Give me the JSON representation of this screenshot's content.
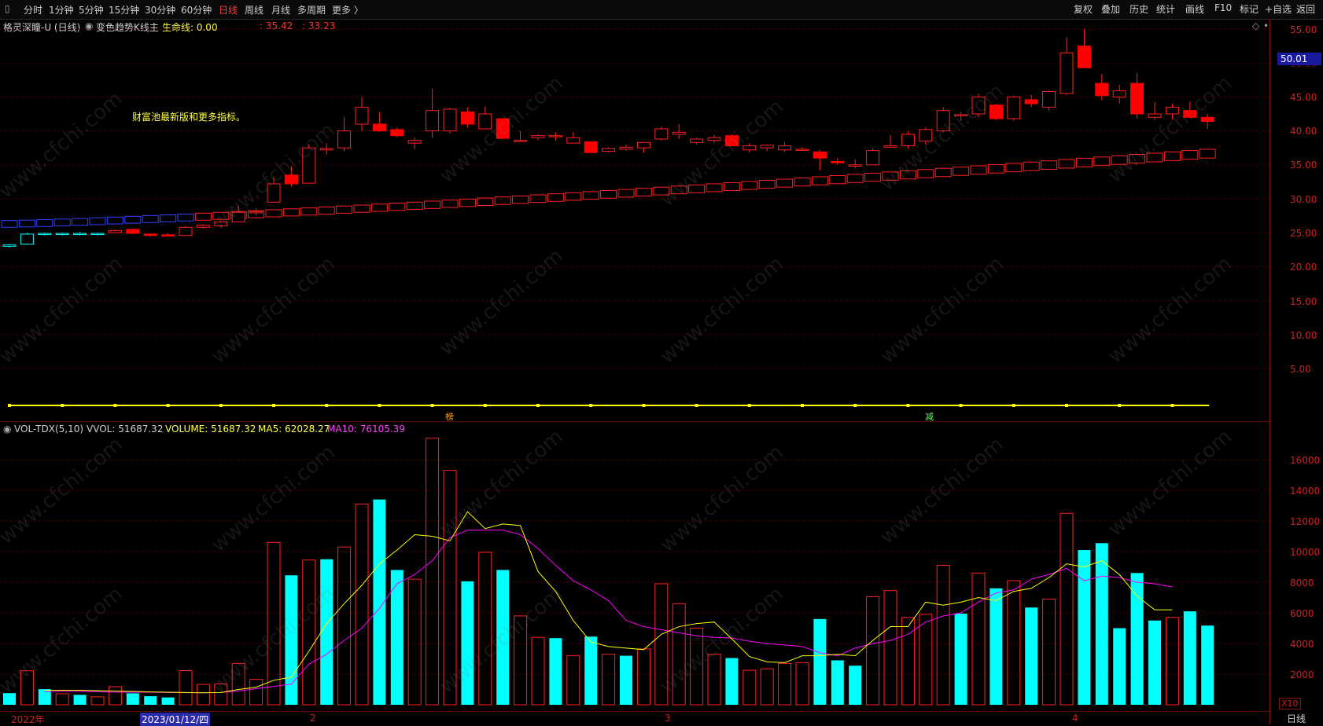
{
  "toolbar": {
    "left_items": [
      "分时",
      "1分钟",
      "5分钟",
      "15分钟",
      "30分钟",
      "60分钟",
      "日线",
      "周线",
      "月线",
      "多周期",
      "更多 〉"
    ],
    "active_item": "日线",
    "right_items": [
      "复权",
      "叠加",
      "历史",
      "统计",
      "画线",
      "F10",
      "标记",
      "+自选",
      "返回"
    ]
  },
  "price_header": {
    "stock": "格灵深瞳-U (日线)",
    "indicator": "变色趋势K线主",
    "lifeline_label": "生命线: 0.00",
    "v1": ": 35.42",
    "v2": ": 33.23"
  },
  "note_text": "财富池最新版和更多指标。",
  "markers": {
    "m1": "榜",
    "m2": "减"
  },
  "volume_header": {
    "name": "VOL-TDX(5,10)",
    "vvol": "VVOL: 51687.32",
    "volume": "VOLUME: 51687.32",
    "ma5": "MA5: 62028.27",
    "ma10": "MA10: 76105.39"
  },
  "price_axis": [
    "55.00",
    "50.00",
    "45.00",
    "40.00",
    "35.00",
    "30.00",
    "25.00",
    "20.00",
    "15.00",
    "10.00",
    "5.00"
  ],
  "price_badge": "50.01",
  "volume_axis": [
    "16000",
    "14000",
    "12000",
    "10000",
    "8000",
    "6000",
    "4000",
    "2000"
  ],
  "volume_unit": "X10",
  "dates": {
    "d1": "2022年",
    "d2": "2023/01/12/四",
    "d3": "2",
    "d4": "3",
    "d5": "4"
  },
  "period_label": "日线",
  "watermark": "www.cfchi.com",
  "colors": {
    "up": "#ff2020",
    "down_fill": "#ff0000",
    "cyan": "#00ffff",
    "lifeline": "#ffff00",
    "ma5": "#ffff00",
    "ma10": "#ff00ff",
    "trend_blue": "#3040ff"
  },
  "chart_data": {
    "type": "candlestick",
    "candles": [
      [
        23.0,
        23.3,
        22.8,
        23.2,
        "c"
      ],
      [
        23.3,
        25.0,
        23.2,
        24.8,
        "c"
      ],
      [
        24.9,
        25.0,
        24.6,
        24.8,
        "c"
      ],
      [
        24.8,
        25.0,
        24.6,
        24.9,
        "c"
      ],
      [
        24.9,
        25.1,
        24.6,
        24.8,
        "c"
      ],
      [
        24.8,
        25.0,
        24.6,
        24.9,
        "c"
      ],
      [
        25.0,
        25.5,
        24.9,
        25.3,
        "r"
      ],
      [
        25.5,
        25.6,
        24.8,
        24.9,
        "f"
      ],
      [
        24.8,
        24.9,
        24.4,
        24.6,
        "f"
      ],
      [
        24.7,
        24.9,
        24.5,
        24.5,
        "f"
      ],
      [
        24.6,
        26.0,
        24.6,
        25.8,
        "r"
      ],
      [
        25.8,
        26.3,
        25.6,
        26.1,
        "r"
      ],
      [
        26.0,
        26.8,
        25.8,
        26.6,
        "r"
      ],
      [
        26.6,
        29.0,
        26.5,
        28.0,
        "r"
      ],
      [
        28.0,
        28.6,
        27.6,
        28.1,
        "r"
      ],
      [
        29.5,
        33.2,
        29.5,
        32.2,
        "r"
      ],
      [
        32.2,
        34.8,
        31.8,
        33.5,
        "f"
      ],
      [
        32.3,
        38.0,
        32.3,
        37.5,
        "r"
      ],
      [
        37.4,
        38.2,
        36.5,
        37.2,
        "r"
      ],
      [
        37.5,
        42.0,
        37.0,
        40.0,
        "r"
      ],
      [
        41.0,
        45.0,
        40.0,
        43.5,
        "r"
      ],
      [
        41.0,
        42.8,
        39.8,
        40.0,
        "f"
      ],
      [
        40.2,
        40.5,
        39.1,
        39.3,
        "f"
      ],
      [
        38.6,
        39.0,
        37.3,
        38.2,
        "r"
      ],
      [
        40.0,
        46.2,
        39.0,
        43.0,
        "r"
      ],
      [
        40.0,
        43.4,
        39.6,
        43.2,
        "r"
      ],
      [
        42.8,
        43.5,
        40.5,
        41.0,
        "f"
      ],
      [
        40.3,
        43.6,
        40.3,
        42.5,
        "r"
      ],
      [
        41.8,
        41.8,
        38.8,
        38.9,
        "f"
      ],
      [
        38.6,
        40.0,
        38.4,
        38.6,
        "r"
      ],
      [
        39.0,
        39.5,
        38.6,
        39.3,
        "r"
      ],
      [
        39.2,
        39.8,
        38.6,
        39.3,
        "r"
      ],
      [
        39.0,
        39.8,
        38.2,
        38.2,
        "r"
      ],
      [
        38.4,
        38.4,
        36.8,
        36.8,
        "f"
      ],
      [
        37.0,
        37.6,
        36.8,
        37.4,
        "r"
      ],
      [
        37.3,
        38.0,
        37.1,
        37.6,
        "r"
      ],
      [
        37.5,
        38.4,
        36.8,
        38.3,
        "r"
      ],
      [
        38.8,
        40.6,
        38.6,
        40.3,
        "r"
      ],
      [
        39.5,
        41.0,
        38.8,
        39.8,
        "r"
      ],
      [
        38.3,
        39.0,
        38.0,
        38.8,
        "r"
      ],
      [
        38.6,
        39.4,
        38.2,
        39.0,
        "r"
      ],
      [
        39.3,
        39.5,
        37.8,
        37.8,
        "f"
      ],
      [
        37.2,
        38.2,
        36.8,
        37.8,
        "r"
      ],
      [
        37.5,
        38.0,
        37.0,
        37.9,
        "r"
      ],
      [
        37.2,
        38.3,
        36.9,
        37.8,
        "r"
      ],
      [
        37.3,
        37.6,
        37.1,
        37.2,
        "r"
      ],
      [
        36.9,
        37.2,
        34.2,
        36.0,
        "f"
      ],
      [
        35.5,
        36.0,
        35.0,
        35.3,
        "f"
      ],
      [
        34.8,
        35.8,
        34.5,
        35.0,
        "r"
      ],
      [
        35.0,
        37.4,
        35.0,
        37.1,
        "r"
      ],
      [
        37.6,
        39.4,
        37.5,
        37.8,
        "r"
      ],
      [
        37.8,
        40.0,
        37.4,
        39.5,
        "r"
      ],
      [
        38.5,
        40.5,
        38.0,
        40.2,
        "r"
      ],
      [
        40.0,
        43.5,
        39.8,
        43.0,
        "r"
      ],
      [
        42.3,
        42.8,
        41.5,
        42.4,
        "r"
      ],
      [
        42.5,
        45.5,
        42.0,
        45.0,
        "r"
      ],
      [
        43.8,
        44.0,
        41.6,
        41.8,
        "f"
      ],
      [
        41.8,
        45.2,
        41.5,
        45.0,
        "r"
      ],
      [
        44.6,
        45.3,
        43.5,
        44.0,
        "f"
      ],
      [
        43.5,
        46.0,
        43.0,
        45.8,
        "r"
      ],
      [
        45.5,
        53.8,
        45.3,
        51.5,
        "r"
      ],
      [
        52.5,
        55.0,
        49.2,
        49.3,
        "f"
      ],
      [
        47.0,
        48.4,
        44.5,
        45.2,
        "f"
      ],
      [
        45.0,
        46.8,
        44.0,
        45.9,
        "r"
      ],
      [
        47.0,
        48.5,
        41.8,
        42.5,
        "f"
      ],
      [
        42.5,
        44.2,
        41.6,
        42.0,
        "r"
      ],
      [
        42.5,
        44.0,
        41.6,
        43.5,
        "r"
      ],
      [
        43.0,
        44.3,
        41.9,
        42.0,
        "f"
      ],
      [
        42.0,
        42.5,
        40.3,
        41.4,
        "f"
      ]
    ],
    "lifeline": 1.5,
    "trend_lower": [
      25.8,
      36.0
    ],
    "trend_upper": [
      26.8,
      37.3
    ],
    "volume": [
      760,
      2220,
      1020,
      720,
      650,
      520,
      1180,
      750,
      560,
      480,
      2230,
      1330,
      1370,
      2700,
      1660,
      10600,
      8450,
      9450,
      9500,
      10300,
      13100,
      13400,
      8800,
      8200,
      17400,
      15300,
      8060,
      9950,
      8800,
      5800,
      4400,
      4350,
      3200,
      4450,
      3300,
      3200,
      3650,
      7900,
      6600,
      5000,
      3300,
      3050,
      2250,
      2350,
      2700,
      2750,
      5600,
      2900,
      2550,
      7050,
      7450,
      5700,
      5900,
      9100,
      5950,
      8600,
      7600,
      8100,
      6350,
      6900,
      12500,
      10100,
      10550,
      5000,
      8600,
      5500,
      5700,
      6100,
      5170
    ],
    "volume_fill": [
      "c",
      "r",
      "c",
      "r",
      "c",
      "r",
      "r",
      "c",
      "c",
      "c",
      "r",
      "r",
      "r",
      "r",
      "r",
      "r",
      "c",
      "r",
      "c",
      "r",
      "r",
      "c",
      "c",
      "r",
      "r",
      "r",
      "c",
      "r",
      "c",
      "r",
      "r",
      "c",
      "r",
      "c",
      "r",
      "c",
      "r",
      "r",
      "r",
      "r",
      "r",
      "c",
      "r",
      "r",
      "r",
      "r",
      "c",
      "c",
      "c",
      "r",
      "r",
      "r",
      "r",
      "r",
      "c",
      "r",
      "c",
      "r",
      "c",
      "r",
      "r",
      "c",
      "c",
      "c",
      "c",
      "c",
      "r",
      "c",
      "c"
    ],
    "ma5": [
      950,
      950,
      950,
      920,
      900,
      870,
      840,
      820,
      800,
      780,
      800,
      1000,
      1150,
      1600,
      1800,
      3500,
      5300,
      6600,
      7800,
      9200,
      10100,
      11100,
      11000,
      10700,
      12600,
      11500,
      11800,
      11700,
      8700,
      7400,
      5500,
      4100,
      3800,
      3700,
      3600,
      4600,
      5100,
      5300,
      5400,
      4300,
      3150,
      2800,
      2750,
      3200,
      3200,
      3300,
      3200,
      4200,
      5100,
      5100,
      6700,
      6500,
      6700,
      7000,
      6800,
      7400,
      7600,
      8300,
      9200,
      9000,
      9400,
      8500,
      7100,
      6200,
      6200
    ],
    "ma10": [
      850,
      880,
      880,
      850,
      820,
      820,
      820,
      800,
      790,
      790,
      800,
      900,
      1050,
      1200,
      1350,
      2650,
      3300,
      4200,
      5000,
      6300,
      7900,
      8500,
      9400,
      10900,
      11400,
      11400,
      11400,
      11100,
      10200,
      9100,
      8100,
      7500,
      6800,
      5500,
      5100,
      4900,
      4700,
      4500,
      4400,
      4350,
      4150,
      4000,
      3900,
      3800,
      3400,
      3200,
      3700,
      4000,
      4200,
      4600,
      5400,
      5800,
      6000,
      6700,
      7300,
      7500,
      8200,
      8500,
      8900,
      8100,
      8400,
      8300,
      8000,
      7900,
      7700
    ],
    "xlabel": "",
    "ylabel": ""
  }
}
